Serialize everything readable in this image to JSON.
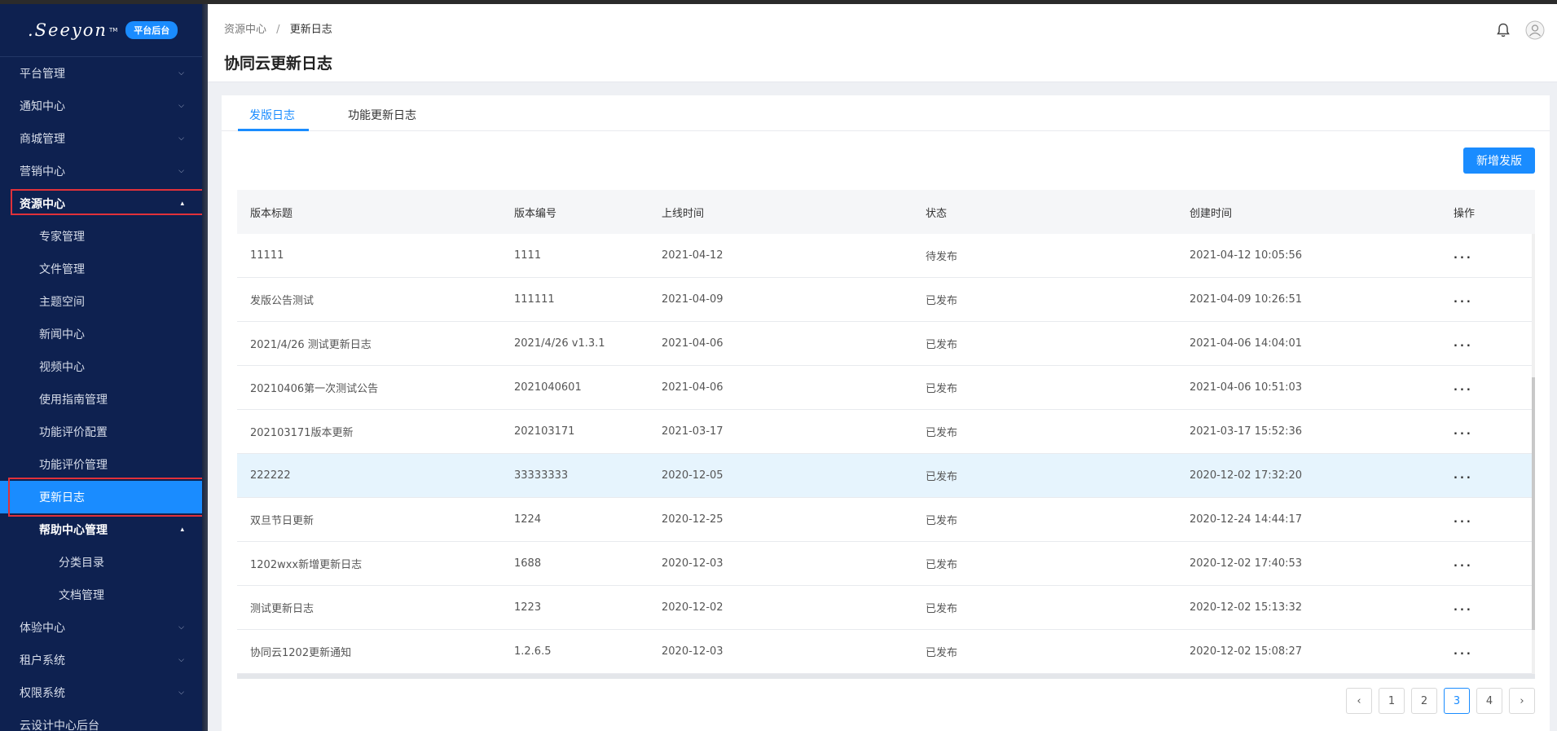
{
  "brand": {
    "logo": ".Seeyon",
    "tm": "TM",
    "badge": "平台后台"
  },
  "sidebar": {
    "items": [
      {
        "label": "平台管理"
      },
      {
        "label": "通知中心"
      },
      {
        "label": "商城管理"
      },
      {
        "label": "营销中心"
      },
      {
        "label": "资源中心"
      },
      {
        "label": "专家管理"
      },
      {
        "label": "文件管理"
      },
      {
        "label": "主题空间"
      },
      {
        "label": "新闻中心"
      },
      {
        "label": "视频中心"
      },
      {
        "label": "使用指南管理"
      },
      {
        "label": "功能评价配置"
      },
      {
        "label": "功能评价管理"
      },
      {
        "label": "更新日志"
      },
      {
        "label": "帮助中心管理"
      },
      {
        "label": "分类目录"
      },
      {
        "label": "文档管理"
      },
      {
        "label": "体验中心"
      },
      {
        "label": "租户系统"
      },
      {
        "label": "权限系统"
      },
      {
        "label": "云设计中心后台"
      }
    ]
  },
  "header": {
    "breadcrumb": [
      "资源中心",
      "更新日志"
    ],
    "separator": "/",
    "title": "协同云更新日志"
  },
  "tabs": [
    {
      "label": "发版日志"
    },
    {
      "label": "功能更新日志"
    }
  ],
  "toolbar": {
    "add_label": "新增发版"
  },
  "table": {
    "columns": [
      "版本标题",
      "版本编号",
      "上线时间",
      "状态",
      "创建时间",
      "操作"
    ],
    "rows": [
      {
        "title": "11111",
        "version": "1111",
        "online": "2021-04-12",
        "status": "待发布",
        "created": "2021-04-12 10:05:56",
        "action": "..."
      },
      {
        "title": "发版公告测试",
        "version": "111111",
        "online": "2021-04-09",
        "status": "已发布",
        "created": "2021-04-09 10:26:51",
        "action": "..."
      },
      {
        "title": "2021/4/26 测试更新日志",
        "version": "2021/4/26 v1.3.1",
        "online": "2021-04-06",
        "status": "已发布",
        "created": "2021-04-06 14:04:01",
        "action": "..."
      },
      {
        "title": "20210406第一次测试公告",
        "version": "2021040601",
        "online": "2021-04-06",
        "status": "已发布",
        "created": "2021-04-06 10:51:03",
        "action": "..."
      },
      {
        "title": "202103171版本更新",
        "version": "202103171",
        "online": "2021-03-17",
        "status": "已发布",
        "created": "2021-03-17 15:52:36",
        "action": "..."
      },
      {
        "title": "222222",
        "version": "33333333",
        "online": "2020-12-05",
        "status": "已发布",
        "created": "2020-12-02 17:32:20",
        "action": "..."
      },
      {
        "title": "双旦节日更新",
        "version": "1224",
        "online": "2020-12-25",
        "status": "已发布",
        "created": "2020-12-24 14:44:17",
        "action": "..."
      },
      {
        "title": "1202wxx新增更新日志",
        "version": "1688",
        "online": "2020-12-03",
        "status": "已发布",
        "created": "2020-12-02 17:40:53",
        "action": "..."
      },
      {
        "title": "测试更新日志",
        "version": "1223",
        "online": "2020-12-02",
        "status": "已发布",
        "created": "2020-12-02 15:13:32",
        "action": "..."
      },
      {
        "title": "协同云1202更新通知",
        "version": "1.2.6.5",
        "online": "2020-12-03",
        "status": "已发布",
        "created": "2020-12-02 15:08:27",
        "action": "..."
      }
    ]
  },
  "pagination": {
    "pages": [
      "1",
      "2",
      "3",
      "4"
    ],
    "current": "3",
    "prev": "‹",
    "next": "›"
  },
  "colors": {
    "accent": "#1a8cff",
    "sidebar": "#0e2150",
    "highlight": "#e6f4fd",
    "annotation": "#e0313a"
  }
}
